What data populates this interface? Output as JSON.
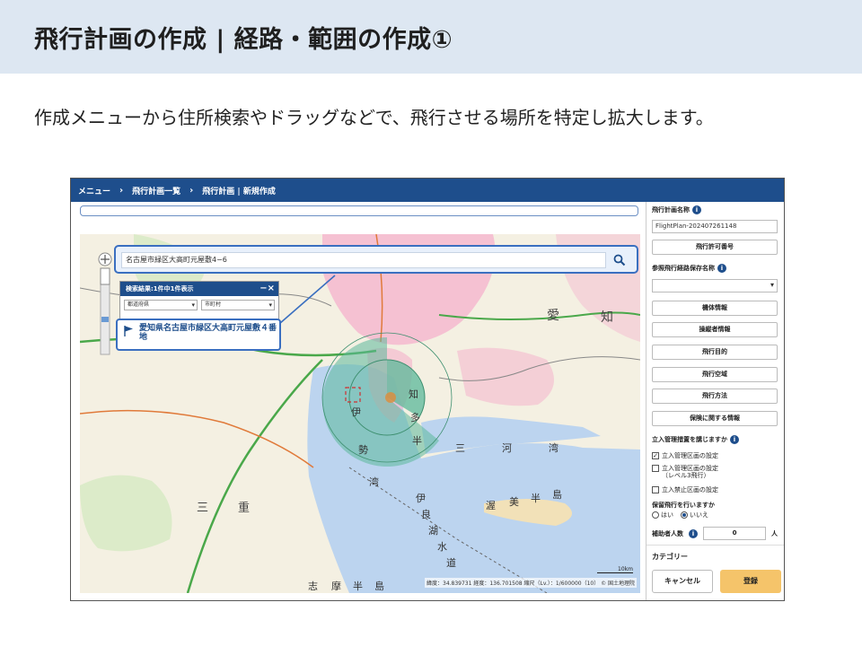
{
  "slide": {
    "title": "飛行計画の作成 | 経路・範囲の作成①",
    "body": "作成メニューから住所検索やドラッグなどで、飛行させる場所を特定し拡大します。"
  },
  "nav": {
    "items": [
      "メニュー",
      "飛行計画一覧",
      "飛行計画 | 新規作成"
    ],
    "separator": "›"
  },
  "search": {
    "value": "名古屋市緑区大高町元屋敷4−6"
  },
  "results": {
    "header": "検索結果:1件中1件表示",
    "close": "−×",
    "prefecture_select": "都道府県",
    "city_select": "市町村",
    "item": "愛知県名古屋市緑区大高町元屋敷４番地"
  },
  "map": {
    "labels": {
      "aichi_1": "愛",
      "aichi_2": "知",
      "mie_1": "三",
      "mie_2": "重",
      "ise_1": "伊",
      "ise_2": "勢",
      "ise_3": "湾",
      "chita_1": "知",
      "chita_2": "多",
      "chita_3": "半",
      "mikawa_1": "三",
      "mikawa_2": "河",
      "mikawa_3": "湾",
      "atsumi_1": "渥",
      "atsumi_2": "美",
      "atsumi_3": "半",
      "atsumi_4": "島",
      "shima_1": "志",
      "shima_2": "摩",
      "shima_3": "半",
      "shima_4": "島",
      "channel_1": "伊",
      "channel_2": "良",
      "channel_3": "湖",
      "channel_4": "水",
      "channel_5": "道"
    },
    "scale": "10km",
    "status": "緯度：34.839731 経度：136.701508 縮尺（Lv.）：1/600000（10）  © 国土地理院"
  },
  "panel": {
    "plan_name_label": "飛行計画名称",
    "plan_name_value": "FlightPlan-202407261148",
    "permit_button": "飛行許可番号",
    "reference_label": "参照飛行経路保存名称",
    "buttons": [
      "機体情報",
      "操縦者情報",
      "飛行目的",
      "飛行空域",
      "飛行方法",
      "保険に関する情報"
    ],
    "entry_label": "立入管理措置を講じますか",
    "checkboxes": [
      {
        "label": "立入管理区画の設定",
        "checked": true
      },
      {
        "label": "立入管理区画の設定（レベル3飛行）",
        "checked": false
      },
      {
        "label": "立入禁止区画の設定",
        "checked": false
      }
    ],
    "line1": "立入管理区画の設定",
    "line2a": "立入管理区画の設定",
    "line2b": "（レベル3飛行）",
    "line3": "立入禁止区画の設定",
    "escort_label": "保留飛行を行いますか",
    "radio_yes": "はい",
    "radio_no": "いいえ",
    "assistants_label": "補助者人数",
    "assistants_value": "0",
    "assistants_unit": "人",
    "category_label": "カテゴリー",
    "cancel": "キャンセル",
    "register": "登録"
  },
  "colors": {
    "header_bg": "#dde7f2",
    "nav_bg": "#1e4e8c",
    "accent_border": "#3a6fc0",
    "register_bg": "#f5c46a",
    "flight_area": "#4caf8a"
  }
}
